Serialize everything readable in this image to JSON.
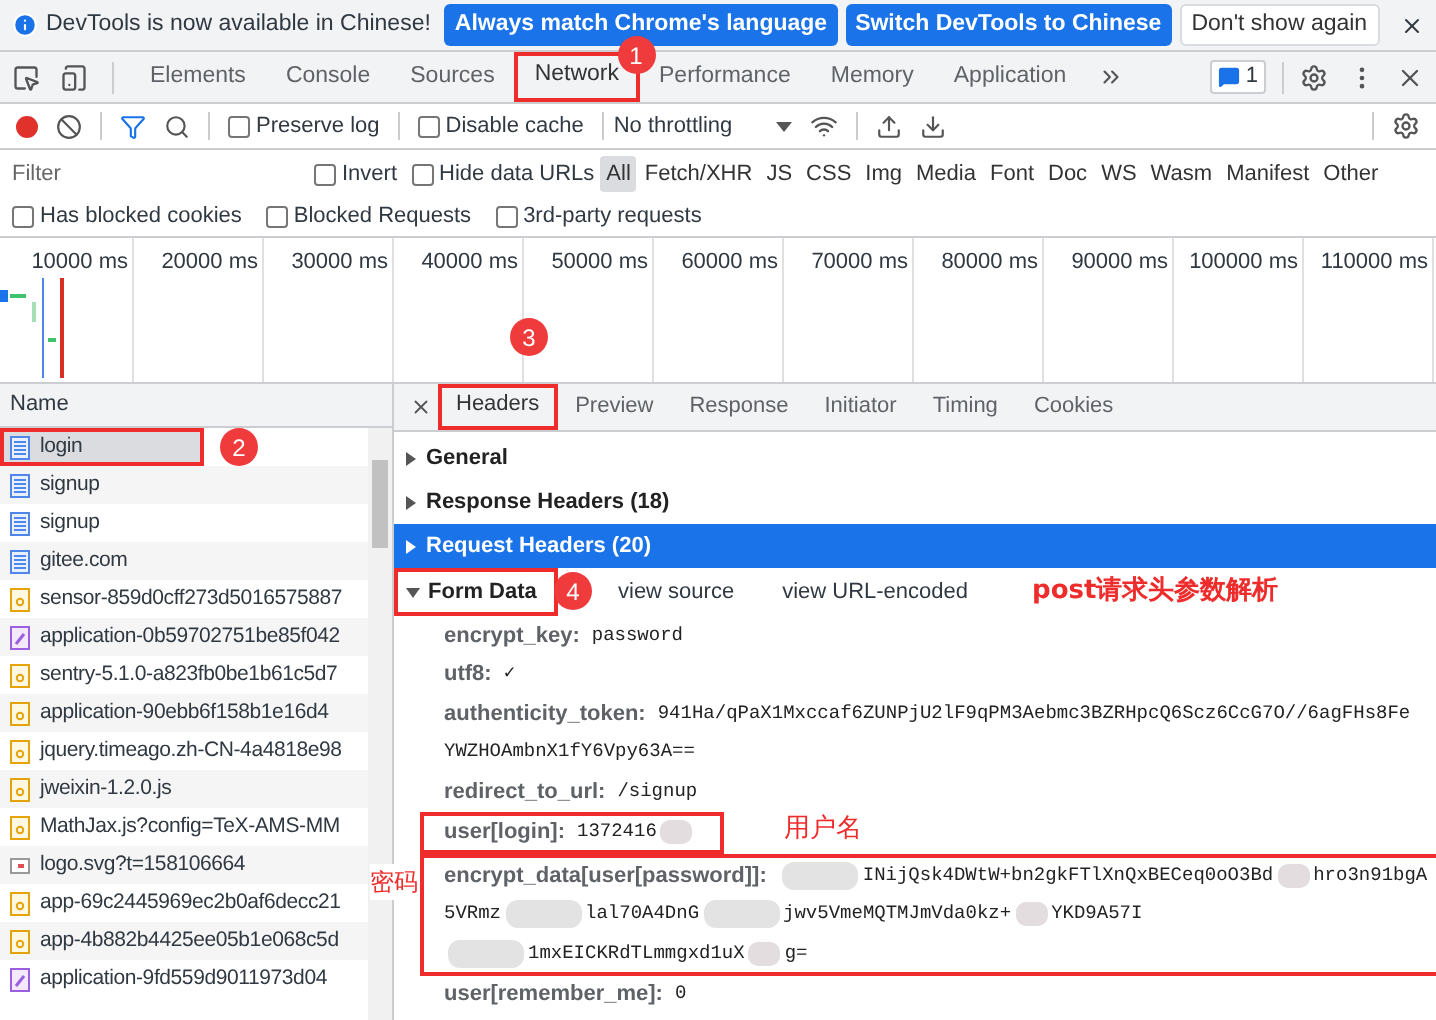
{
  "infobar": {
    "message": "DevTools is now available in Chinese!",
    "buttons": [
      {
        "label": "Always match Chrome's language",
        "kind": "primary"
      },
      {
        "label": "Switch DevTools to Chinese",
        "kind": "primary"
      },
      {
        "label": "Don't show again",
        "kind": "secondary"
      }
    ]
  },
  "main_tabs": [
    {
      "label": "Elements",
      "selected": false,
      "framed": false
    },
    {
      "label": "Console",
      "selected": false,
      "framed": false
    },
    {
      "label": "Sources",
      "selected": false,
      "framed": false
    },
    {
      "label": "Network",
      "selected": true,
      "framed": true
    },
    {
      "label": "Performance",
      "selected": false,
      "framed": false
    },
    {
      "label": "Memory",
      "selected": false,
      "framed": false
    },
    {
      "label": "Application",
      "selected": false,
      "framed": false
    }
  ],
  "issues_count": "1",
  "toolbar": {
    "recording": true,
    "checkboxes": [
      {
        "label": "Preserve log",
        "checked": false
      },
      {
        "label": "Disable cache",
        "checked": false
      }
    ],
    "throttling": "No throttling"
  },
  "filter": {
    "placeholder": "Filter",
    "checkboxes": [
      {
        "label": "Invert",
        "checked": false
      },
      {
        "label": "Hide data URLs",
        "checked": false
      }
    ],
    "types": [
      {
        "label": "All",
        "selected": true
      },
      {
        "label": "Fetch/XHR",
        "selected": false
      },
      {
        "label": "JS",
        "selected": false
      },
      {
        "label": "CSS",
        "selected": false
      },
      {
        "label": "Img",
        "selected": false
      },
      {
        "label": "Media",
        "selected": false
      },
      {
        "label": "Font",
        "selected": false
      },
      {
        "label": "Doc",
        "selected": false
      },
      {
        "label": "WS",
        "selected": false
      },
      {
        "label": "Wasm",
        "selected": false
      },
      {
        "label": "Manifest",
        "selected": false
      },
      {
        "label": "Other",
        "selected": false
      }
    ]
  },
  "blocked_filters": [
    {
      "label": "Has blocked cookies",
      "checked": false
    },
    {
      "label": "Blocked Requests",
      "checked": false
    },
    {
      "label": "3rd-party requests",
      "checked": false
    }
  ],
  "timeline": {
    "ticks": [
      "10000 ms",
      "20000 ms",
      "30000 ms",
      "40000 ms",
      "50000 ms",
      "60000 ms",
      "70000 ms",
      "80000 ms",
      "90000 ms",
      "100000 ms",
      "110000 ms"
    ]
  },
  "requests": {
    "column": "Name",
    "rows": [
      {
        "name": "login",
        "kind": "document",
        "selected": true,
        "framed": true
      },
      {
        "name": "signup",
        "kind": "document",
        "selected": false,
        "framed": false
      },
      {
        "name": "signup",
        "kind": "document",
        "selected": false,
        "framed": false
      },
      {
        "name": "gitee.com",
        "kind": "document",
        "selected": false,
        "framed": false
      },
      {
        "name": "sensor-859d0cff273d5016575887",
        "kind": "script",
        "selected": false,
        "framed": false
      },
      {
        "name": "application-0b59702751be85f042",
        "kind": "stylesheet",
        "selected": false,
        "framed": false
      },
      {
        "name": "sentry-5.1.0-a823fb0be1b61c5d7",
        "kind": "script",
        "selected": false,
        "framed": false
      },
      {
        "name": "application-90ebb6f158b1e16d4",
        "kind": "script",
        "selected": false,
        "framed": false
      },
      {
        "name": "jquery.timeago.zh-CN-4a4818e98",
        "kind": "script",
        "selected": false,
        "framed": false
      },
      {
        "name": "jweixin-1.2.0.js",
        "kind": "script",
        "selected": false,
        "framed": false
      },
      {
        "name": "MathJax.js?config=TeX-AMS-MM",
        "kind": "script",
        "selected": false,
        "framed": false
      },
      {
        "name": "logo.svg?t=158106664",
        "kind": "image",
        "selected": false,
        "framed": false
      },
      {
        "name": "app-69c2445969ec2b0af6decc21",
        "kind": "script",
        "selected": false,
        "framed": false
      },
      {
        "name": "app-4b882b4425ee05b1e068c5d",
        "kind": "script",
        "selected": false,
        "framed": false
      },
      {
        "name": "application-9fd559d9011973d04",
        "kind": "stylesheet",
        "selected": false,
        "framed": false
      }
    ]
  },
  "detail_tabs": [
    {
      "label": "Headers",
      "selected": true,
      "framed": true
    },
    {
      "label": "Preview",
      "selected": false,
      "framed": false
    },
    {
      "label": "Response",
      "selected": false,
      "framed": false
    },
    {
      "label": "Initiator",
      "selected": false,
      "framed": false
    },
    {
      "label": "Timing",
      "selected": false,
      "framed": false
    },
    {
      "label": "Cookies",
      "selected": false,
      "framed": false
    }
  ],
  "sections": [
    {
      "title": "General",
      "expanded": false,
      "highlighted": false
    },
    {
      "title": "Response Headers (18)",
      "expanded": false,
      "highlighted": false
    },
    {
      "title": "Request Headers (20)",
      "expanded": false,
      "highlighted": true
    }
  ],
  "form_data": {
    "title": "Form Data",
    "expanded": true,
    "framed": true,
    "links": [
      "view source",
      "view URL-encoded"
    ],
    "fields": [
      {
        "name": "encrypt_key:",
        "framed": false,
        "lines": [
          [
            {
              "kind": "text",
              "text": "password"
            }
          ]
        ]
      },
      {
        "name": "utf8:",
        "framed": false,
        "lines": [
          [
            {
              "kind": "text",
              "text": "✓"
            }
          ]
        ]
      },
      {
        "name": "authenticity_token:",
        "framed": false,
        "lines": [
          [
            {
              "kind": "text",
              "text": "941Ha/qPaX1Mxccaf6ZUNPjU2lF9qPM3Aebmc3BZRHpcQ6Scz6CcG7O//6agFHs8Fe"
            }
          ],
          [
            {
              "kind": "text",
              "text": "YWZHOAmbnX1fY6Vpy63A=="
            }
          ]
        ]
      },
      {
        "name": "redirect_to_url:",
        "framed": false,
        "lines": [
          [
            {
              "kind": "text",
              "text": "/signup"
            }
          ]
        ]
      },
      {
        "name": "user[login]:",
        "framed": true,
        "lines": [
          [
            {
              "kind": "text",
              "text": "1372416"
            },
            {
              "kind": "redacted_short"
            }
          ]
        ]
      },
      {
        "name": "encrypt_data[user[password]]:",
        "framed": true,
        "lines": [
          [
            {
              "kind": "redacted_long"
            },
            {
              "kind": "text",
              "text": "INijQsk4DWtW+bn2gkFTlXnQxBECeq0oO3Bd"
            },
            {
              "kind": "redacted_short"
            },
            {
              "kind": "text",
              "text": "hro3n91bgA"
            }
          ],
          [
            {
              "kind": "text",
              "text": "5VRmz"
            },
            {
              "kind": "redacted_long"
            },
            {
              "kind": "text",
              "text": "lal70A4DnG"
            },
            {
              "kind": "redacted_long"
            },
            {
              "kind": "text",
              "text": "jwv5VmeMQTMJmVda0kz+"
            },
            {
              "kind": "redacted_short"
            },
            {
              "kind": "text",
              "text": "YKD9A57I"
            }
          ],
          [
            {
              "kind": "redacted_long"
            },
            {
              "kind": "text",
              "text": "1mxEICKRdTLmmgxd1uX"
            },
            {
              "kind": "redacted_short"
            },
            {
              "kind": "text",
              "text": "g="
            }
          ]
        ]
      },
      {
        "name": "user[remember_me]:",
        "framed": false,
        "lines": [
          [
            {
              "kind": "text",
              "text": "0"
            }
          ]
        ]
      }
    ]
  },
  "annotations": {
    "tab_marker": "1",
    "request_marker": "2",
    "headers_marker": "3",
    "form_marker": "4",
    "form_note": "post请求头参数解析",
    "login_note": "用户名",
    "password_note": "密码"
  }
}
